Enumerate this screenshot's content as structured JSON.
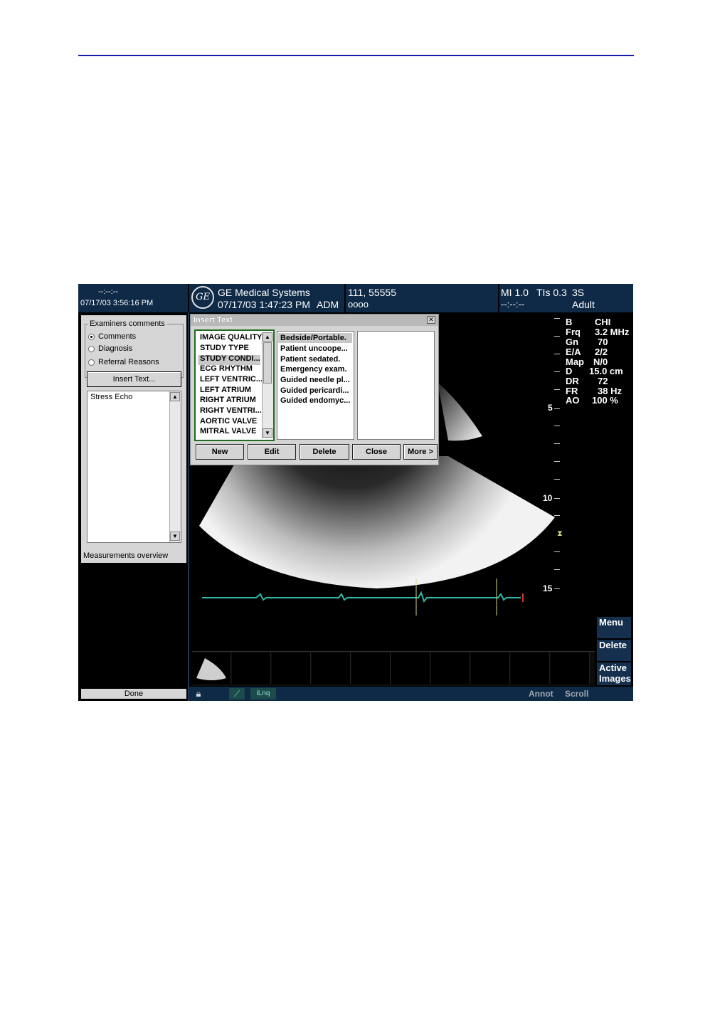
{
  "header": {
    "left_top": "--:--:--",
    "left_datetime": "07/17/03 3:56:16 PM",
    "logo": "GE",
    "brand": "GE Medical Systems",
    "study_datetime": "07/17/03 1:47:23 PM",
    "operator": "ADM",
    "patient_id": "111, 55555",
    "patient_sub": "oooo",
    "mi": "MI 1.0",
    "tis": "TIs 0.3",
    "probe": "3S",
    "time_sub": "--:--:--",
    "preset": "Adult"
  },
  "left_panel": {
    "group_title": "Examiners comments",
    "options": [
      "Comments",
      "Diagnosis",
      "Referral Reasons"
    ],
    "selected_option": "Comments",
    "insert_button": "Insert Text...",
    "comment_text": "Stress Echo",
    "measurements_label": "Measurements overview",
    "done_button": "Done"
  },
  "dialog": {
    "title": "Insert Text",
    "categories": [
      "IMAGE QUALITY",
      "STUDY TYPE",
      "STUDY CONDI...",
      "ECG RHYTHM",
      "LEFT VENTRIC...",
      "LEFT ATRIUM",
      "RIGHT ATRIUM",
      "RIGHT VENTRI...",
      "AORTIC VALVE",
      "MITRAL VALVE"
    ],
    "selected_category": "STUDY CONDI...",
    "phrases": [
      "Bedside/Portable.",
      "Patient uncoope...",
      "Patient sedated.",
      "Emergency exam.",
      "Guided needle pl...",
      "Guided pericardi...",
      "Guided endomyc..."
    ],
    "selected_phrase": "Bedside/Portable.",
    "buttons": {
      "new": "New",
      "edit": "Edit",
      "delete": "Delete",
      "close": "Close",
      "more": "More >"
    }
  },
  "params": [
    {
      "label": "B",
      "value": "CHI"
    },
    {
      "label": "Frq",
      "value": "3.2 MHz"
    },
    {
      "label": "Gn",
      "value": "70"
    },
    {
      "label": "E/A",
      "value": "2/2"
    },
    {
      "label": "Map",
      "value": "N/0"
    },
    {
      "label": "D",
      "value": "15.0 cm"
    },
    {
      "label": "DR",
      "value": "72"
    },
    {
      "label": "FR",
      "value": "38 Hz"
    },
    {
      "label": "AO",
      "value": "100 %"
    }
  ],
  "depth_labels": [
    "5",
    "10",
    "15"
  ],
  "right_menu": {
    "menu": "Menu",
    "delete": "Delete",
    "active_images_1": "Active",
    "active_images_2": "Images"
  },
  "bottom_bar": {
    "iliq": "iLnq",
    "annot": "Annot",
    "scroll": "Scroll"
  },
  "colors": {
    "header_bg": "#0f2a47",
    "ecg": "#2fb8a8",
    "dialog_list_border": "#1f6b1f",
    "rule": "#1a1aa8"
  }
}
